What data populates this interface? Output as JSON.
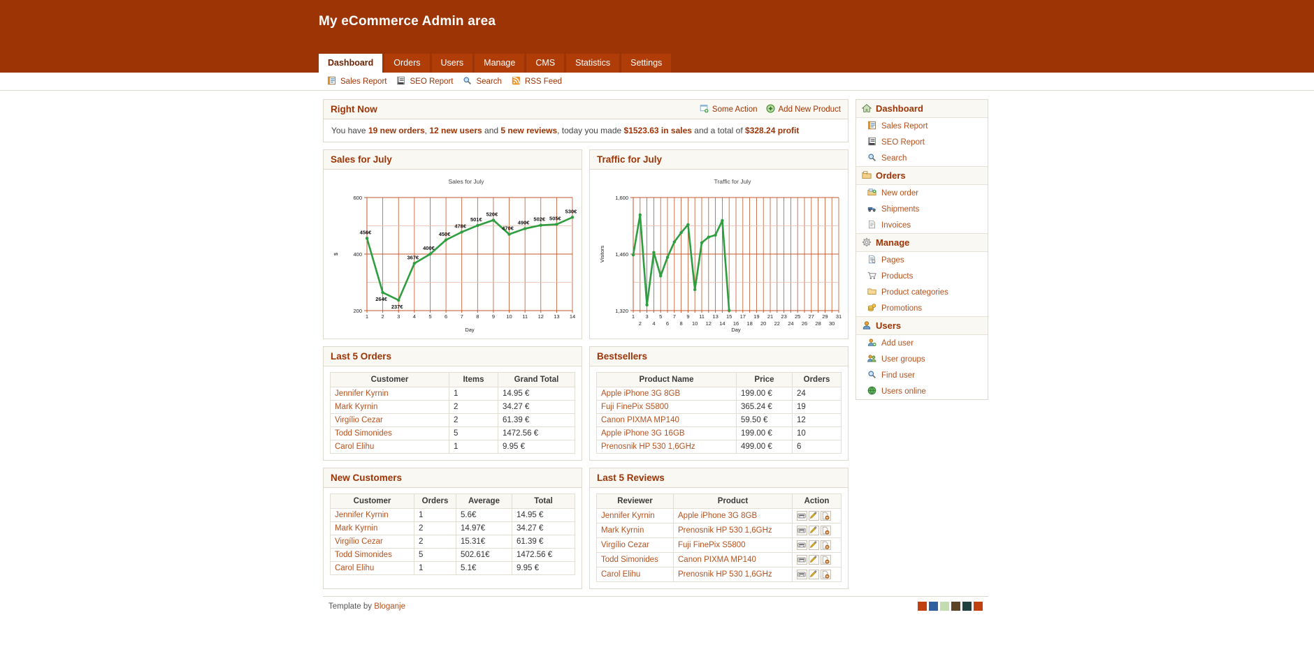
{
  "header": {
    "title": "My eCommerce Admin area",
    "brand_color": "#9c3406",
    "tab_color": "#b03d08",
    "tabs": [
      {
        "label": "Dashboard",
        "active": true
      },
      {
        "label": "Orders",
        "active": false
      },
      {
        "label": "Users",
        "active": false
      },
      {
        "label": "Manage",
        "active": false
      },
      {
        "label": "CMS",
        "active": false
      },
      {
        "label": "Statistics",
        "active": false
      },
      {
        "label": "Settings",
        "active": false
      }
    ]
  },
  "toolbar": {
    "links": [
      {
        "label": "Sales Report",
        "icon": "report-icon"
      },
      {
        "label": "SEO Report",
        "icon": "seo-report-icon"
      },
      {
        "label": "Search",
        "icon": "search-icon"
      },
      {
        "label": "RSS Feed",
        "icon": "rss-icon"
      }
    ]
  },
  "right_now": {
    "title": "Right Now",
    "actions": [
      {
        "label": "Some Action",
        "icon": "window-add-icon"
      },
      {
        "label": "Add New Product",
        "icon": "plus-circle-icon"
      }
    ],
    "text": {
      "p1": "You have ",
      "b1": "19 new orders",
      "p2": ", ",
      "b2": "12 new users",
      "p3": " and ",
      "b3": "5 new reviews",
      "p4": ", today you made ",
      "b4": "$1523.63 in sales",
      "p5": " and a total of ",
      "b5": "$328.24 profit"
    }
  },
  "panels": {
    "sales_title": "Sales for July",
    "traffic_title": "Traffic for July",
    "last_orders_title": "Last 5 Orders",
    "bestsellers_title": "Bestsellers",
    "new_customers_title": "New Customers",
    "last_reviews_title": "Last 5 Reviews"
  },
  "chart_data": [
    {
      "type": "line",
      "title": "Sales for July",
      "xlabel": "Day",
      "ylabel": "$",
      "categories": [
        1,
        2,
        3,
        4,
        5,
        6,
        7,
        8,
        9,
        10,
        11,
        12,
        13,
        14
      ],
      "values": [
        456,
        264,
        237,
        367,
        400,
        450,
        478,
        501,
        520,
        470,
        490,
        502,
        505,
        530
      ],
      "point_labels": [
        "456€",
        "264€",
        "237€",
        "367€",
        "400€",
        "450€",
        "478€",
        "501€",
        "520€",
        "470€",
        "490€",
        "502€",
        "505€",
        "530€"
      ],
      "yticks": [
        200,
        400,
        600
      ],
      "ytick_labels": [
        "200",
        "400",
        "600"
      ],
      "ylim": [
        200,
        600
      ],
      "grid": true,
      "line_color": "#2e9e40",
      "grid_color": "#c0552a",
      "legend": "none"
    },
    {
      "type": "line",
      "title": "Traffic for July",
      "xlabel": "Day",
      "ylabel": "Visitors",
      "categories": [
        1,
        2,
        3,
        4,
        5,
        6,
        7,
        8,
        9,
        10,
        11,
        12,
        13,
        14,
        15,
        16,
        17,
        18,
        19,
        20,
        21,
        22,
        23,
        24,
        25,
        26,
        27,
        28,
        29,
        30,
        31
      ],
      "values": [
        1458,
        1557,
        1334,
        1464,
        1406,
        1452,
        1490,
        1513,
        1533,
        1372,
        1488,
        1502,
        1507,
        1543,
        1320,
        null,
        null,
        null,
        null,
        null,
        null,
        null,
        null,
        null,
        null,
        null,
        null,
        null,
        null,
        null,
        null
      ],
      "yticks": [
        1320,
        1460,
        1600
      ],
      "ytick_labels": [
        "1,320",
        "1,460",
        "1,600"
      ],
      "ylim": [
        1320,
        1600
      ],
      "grid": true,
      "line_color": "#2e9e40",
      "grid_color": "#c0552a",
      "legend": "none"
    }
  ],
  "last_orders": {
    "columns": [
      "Customer",
      "Items",
      "Grand Total"
    ],
    "rows": [
      [
        "Jennifer Kyrnin",
        "1",
        "14.95 €"
      ],
      [
        "Mark Kyrnin",
        "2",
        "34.27 €"
      ],
      [
        "Virgílio Cezar",
        "2",
        "61.39 €"
      ],
      [
        "Todd Simonides",
        "5",
        "1472.56 €"
      ],
      [
        "Carol Elihu",
        "1",
        "9.95 €"
      ]
    ]
  },
  "bestsellers": {
    "columns": [
      "Product Name",
      "Price",
      "Orders"
    ],
    "rows": [
      [
        "Apple iPhone 3G 8GB",
        "199.00 €",
        "24"
      ],
      [
        "Fuji FinePix S5800",
        "365.24 €",
        "19"
      ],
      [
        "Canon PIXMA MP140",
        "59.50 €",
        "12"
      ],
      [
        "Apple iPhone 3G 16GB",
        "199.00 €",
        "10"
      ],
      [
        "Prenosnik HP 530 1,6GHz",
        "499.00 €",
        "6"
      ]
    ]
  },
  "new_customers": {
    "columns": [
      "Customer",
      "Orders",
      "Average",
      "Total"
    ],
    "rows": [
      [
        "Jennifer Kyrnin",
        "1",
        "5.6€",
        "14.95 €"
      ],
      [
        "Mark Kyrnin",
        "2",
        "14.97€",
        "34.27 €"
      ],
      [
        "Virgílio Cezar",
        "2",
        "15.31€",
        "61.39 €"
      ],
      [
        "Todd Simonides",
        "5",
        "502.61€",
        "1472.56 €"
      ],
      [
        "Carol Elihu",
        "1",
        "5.1€",
        "9.95 €"
      ]
    ]
  },
  "last_reviews": {
    "columns": [
      "Reviewer",
      "Product",
      "Action"
    ],
    "action_icons": [
      "view-icon",
      "edit-icon",
      "delete-icon"
    ],
    "rows": [
      [
        "Jennifer Kyrnin",
        "Apple iPhone 3G 8GB"
      ],
      [
        "Mark Kyrnin",
        "Prenosnik HP 530 1,6GHz"
      ],
      [
        "Virgílio Cezar",
        "Fuji FinePix S5800"
      ],
      [
        "Todd Simonides",
        "Canon PIXMA MP140"
      ],
      [
        "Carol Elihu",
        "Prenosnik HP 530 1,6GHz"
      ]
    ]
  },
  "sidebar": {
    "groups": [
      {
        "label": "Dashboard",
        "icon": "home-icon",
        "items": [
          {
            "label": "Sales Report",
            "icon": "report-icon"
          },
          {
            "label": "SEO Report",
            "icon": "seo-report-icon"
          },
          {
            "label": "Search",
            "icon": "search-icon"
          }
        ]
      },
      {
        "label": "Orders",
        "icon": "folder-orders-icon",
        "items": [
          {
            "label": "New order",
            "icon": "folder-add-icon"
          },
          {
            "label": "Shipments",
            "icon": "truck-icon"
          },
          {
            "label": "Invoices",
            "icon": "document-icon"
          }
        ]
      },
      {
        "label": "Manage",
        "icon": "gear-icon",
        "items": [
          {
            "label": "Pages",
            "icon": "page-icon"
          },
          {
            "label": "Products",
            "icon": "cart-icon"
          },
          {
            "label": "Product categories",
            "icon": "folder-icon"
          },
          {
            "label": "Promotions",
            "icon": "coins-icon"
          }
        ]
      },
      {
        "label": "Users",
        "icon": "user-icon",
        "items": [
          {
            "label": "Add user",
            "icon": "user-add-icon"
          },
          {
            "label": "User groups",
            "icon": "user-group-icon"
          },
          {
            "label": "Find user",
            "icon": "search-icon"
          },
          {
            "label": "Users online",
            "icon": "globe-icon"
          }
        ]
      }
    ]
  },
  "footer": {
    "text": "Template by ",
    "link": "Bloganje",
    "swatches": [
      "#c0400f",
      "#2f5f9e",
      "#c3dcb0",
      "#5c4326",
      "#20403f",
      "#c0400f"
    ]
  }
}
